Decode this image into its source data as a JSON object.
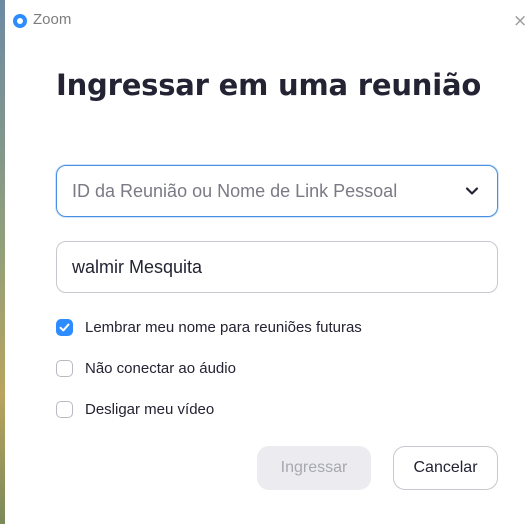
{
  "window": {
    "app_title": "Zoom",
    "close_glyph": "×"
  },
  "page": {
    "title": "Ingressar em uma reunião"
  },
  "meeting_id": {
    "placeholder": "ID da Reunião ou Nome de Link Pessoal"
  },
  "name_field": {
    "value": "walmir Mesquita"
  },
  "options": [
    {
      "label": "Lembrar meu nome para reuniões futuras",
      "checked": true
    },
    {
      "label": "Não conectar ao áudio",
      "checked": false
    },
    {
      "label": "Desligar meu vídeo",
      "checked": false
    }
  ],
  "buttons": {
    "join_label": "Ingressar",
    "cancel_label": "Cancelar"
  },
  "colors": {
    "accent": "#2d8cff",
    "title_text": "#232333",
    "disabled_button_bg": "#ececf0",
    "disabled_button_text": "#a7a7b0"
  },
  "icons": {
    "app_logo": "zoom-logo-icon",
    "close": "close-icon",
    "dropdown": "chevron-down-icon",
    "check": "checkmark-icon"
  }
}
